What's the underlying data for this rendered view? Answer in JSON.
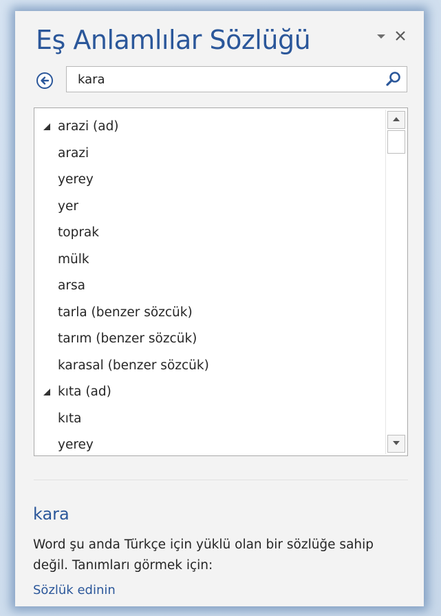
{
  "pane": {
    "title": "Eş Anlamlılar Sözlüğü",
    "dropdown_icon": "chevron-down-icon",
    "close_icon": "close-icon"
  },
  "search": {
    "back_icon": "back-arrow-circle-icon",
    "value": "kara",
    "search_icon": "search-icon"
  },
  "results": {
    "items": [
      {
        "type": "group",
        "label": "arazi (ad)",
        "expanded": true
      },
      {
        "type": "word",
        "label": "arazi"
      },
      {
        "type": "word",
        "label": "yerey"
      },
      {
        "type": "word",
        "label": "yer"
      },
      {
        "type": "word",
        "label": "toprak"
      },
      {
        "type": "word",
        "label": "mülk"
      },
      {
        "type": "word",
        "label": "arsa"
      },
      {
        "type": "word",
        "label": "tarla (benzer sözcük)"
      },
      {
        "type": "word",
        "label": "tarım (benzer sözcük)"
      },
      {
        "type": "word",
        "label": "karasal (benzer sözcük)"
      },
      {
        "type": "group",
        "label": "kıta (ad)",
        "expanded": true
      },
      {
        "type": "word",
        "label": "kıta"
      },
      {
        "type": "word",
        "label": "yerey"
      }
    ]
  },
  "definition": {
    "word": "kara",
    "message": "Word şu anda Türkçe için yüklü olan bir sözlüğe sahip değil. Tanımları görmek için:",
    "link": "Sözlük edinin"
  },
  "colors": {
    "accent": "#2b579a",
    "pane_bg": "#f3f3f3",
    "text": "#262626"
  }
}
